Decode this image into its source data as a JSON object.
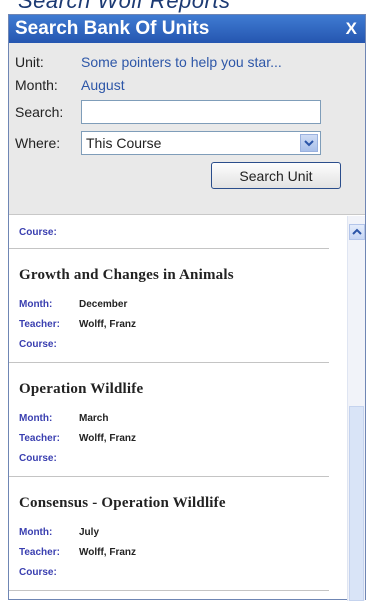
{
  "window": {
    "title": "Search Bank Of Units",
    "close_label": "X"
  },
  "form": {
    "unit_label": "Unit:",
    "unit_value": "Some pointers to help you star...",
    "month_label": "Month:",
    "month_value": "August",
    "search_label": "Search:",
    "search_value": "",
    "where_label": "Where:",
    "where_value": "This Course",
    "search_button": "Search Unit"
  },
  "results": {
    "first_partial": {
      "course_label": "Course:",
      "course_value": ""
    },
    "items": [
      {
        "name": "Growth and Changes in Animals",
        "month_label": "Month:",
        "month": "December",
        "teacher_label": "Teacher:",
        "teacher": "Wolff, Franz",
        "course_label": "Course:",
        "course": ""
      },
      {
        "name": "Operation Wildlife",
        "month_label": "Month:",
        "month": "March",
        "teacher_label": "Teacher:",
        "teacher": "Wolff, Franz",
        "course_label": "Course:",
        "course": ""
      },
      {
        "name": "Consensus - Operation Wildlife",
        "month_label": "Month:",
        "month": "July",
        "teacher_label": "Teacher:",
        "teacher": "Wolff, Franz",
        "course_label": "Course:",
        "course": ""
      }
    ]
  },
  "icons": {
    "dropdown": "chevron-down-icon",
    "scroll_up": "chevron-up-icon"
  },
  "colors": {
    "titlebar": "#2f66c4",
    "link": "#2e57a8",
    "meta_label": "#3a3fb0"
  }
}
